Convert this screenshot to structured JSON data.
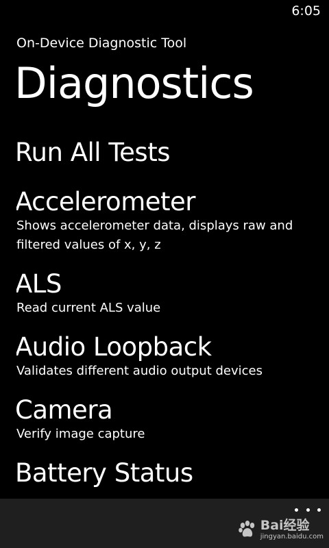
{
  "status_bar": {
    "time": "6:05"
  },
  "header": {
    "app_title": "On-Device Diagnostic Tool",
    "page_title": "Diagnostics"
  },
  "tests": [
    {
      "title": "Run All Tests",
      "description": ""
    },
    {
      "title": "Accelerometer",
      "description": "Shows accelerometer data, displays raw and filtered values of x, y, z"
    },
    {
      "title": "ALS",
      "description": "Read current ALS value"
    },
    {
      "title": "Audio Loopback",
      "description": "Validates different audio output devices"
    },
    {
      "title": "Camera",
      "description": "Verify image capture"
    },
    {
      "title": "Battery Status",
      "description": ""
    }
  ],
  "app_bar": {
    "more_icon": "ellipsis-icon"
  },
  "watermark": {
    "brand": "Bai经验",
    "url": "jingyan.baidu.com",
    "icon": "paw-icon"
  },
  "colors": {
    "background": "#000000",
    "text": "#ffffff",
    "app_bar": "#1f1f1f"
  }
}
